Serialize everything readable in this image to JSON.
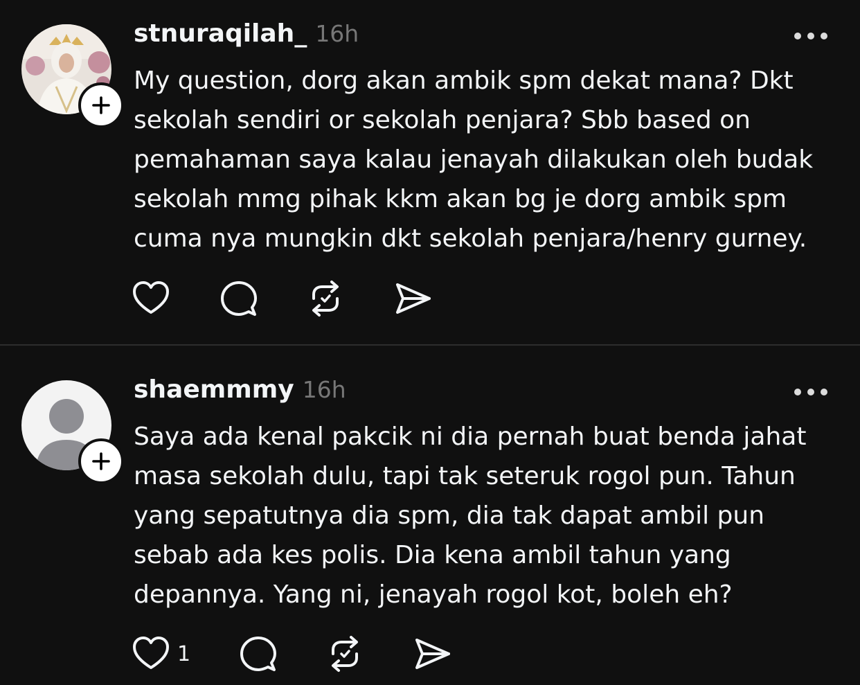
{
  "posts": [
    {
      "username": "stnuraqilah_",
      "time": "16h",
      "text": "My question, dorg akan ambik spm dekat mana? Dkt\nsekolah sendiri or sekolah penjara? Sbb based on\npemahaman saya kalau jenayah dilakukan oleh budak\nsekolah mmg pihak kkm akan bg je dorg ambik spm\ncuma nya mungkin dkt sekolah penjara/henry gurney.",
      "like_count": "",
      "avatar": "profile-photo"
    },
    {
      "username": "shaemmmy",
      "time": "16h",
      "text": "Saya ada kenal pakcik ni dia pernah buat benda jahat\nmasa sekolah dulu, tapi tak seteruk rogol pun. Tahun\nyang sepatutnya dia spm, dia tak dapat ambil pun\nsebab ada kes polis. Dia kena ambil tahun yang\ndepannya. Yang ni, jenayah rogol kot, boleh eh?",
      "like_count": "1",
      "avatar": "default-avatar"
    }
  ],
  "colors": {
    "background": "#101010",
    "text": "#f3f5f7",
    "muted": "#777777",
    "divider": "#2d2d2d"
  },
  "icons": [
    "heart-icon",
    "comment-icon",
    "repost-icon",
    "share-icon",
    "more-icon",
    "plus-icon"
  ]
}
